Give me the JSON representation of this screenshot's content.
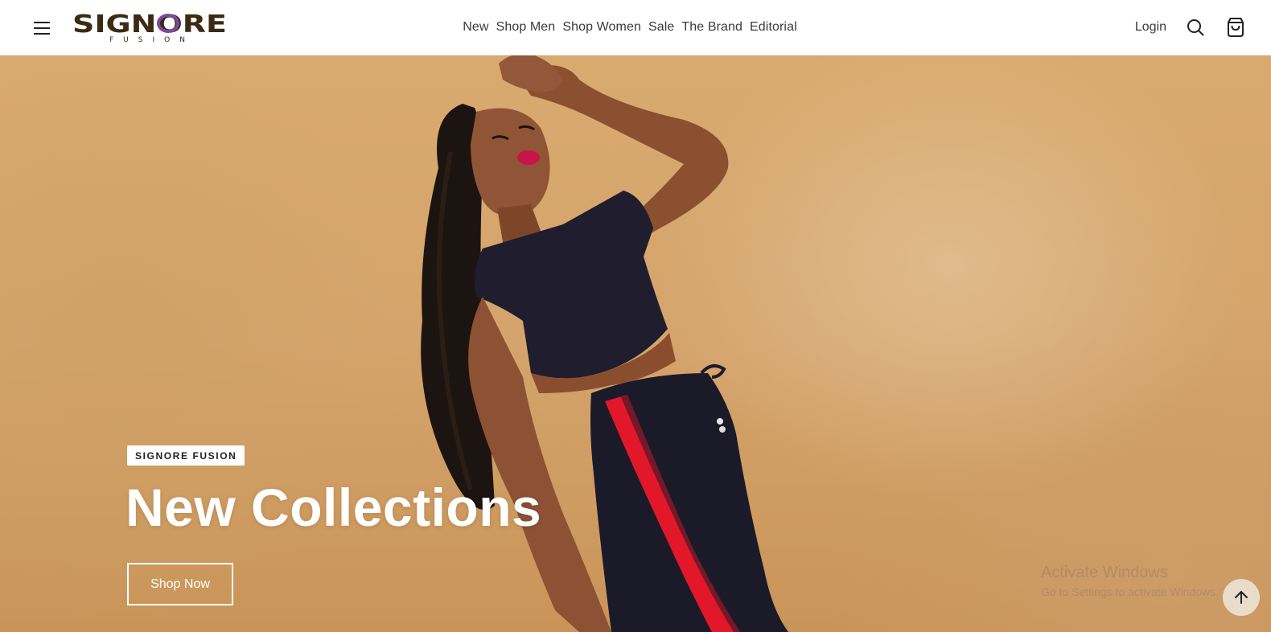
{
  "header": {
    "logo_text": "SIGNORE",
    "logo_subtext": "FUSION",
    "nav": [
      "New",
      "Shop Men",
      "Shop Women",
      "Sale",
      "The Brand",
      "Editorial"
    ],
    "login_label": "Login",
    "icons": {
      "menu": "hamburger-menu-icon",
      "search": "search-icon",
      "cart": "shopping-bag-icon"
    }
  },
  "hero": {
    "tag": "SIGNORE FUSION",
    "title": "New Collections",
    "cta": "Shop Now",
    "image_subject": "model in black crop top and black track pants with red side stripe against tan backdrop"
  },
  "overlay": {
    "watermark_title": "Activate Windows",
    "watermark_subtitle": "Go to Settings to activate Windows.",
    "back_to_top_icon": "arrow-up-icon"
  },
  "colors": {
    "background_tan": "#d4a46c",
    "text_dark": "#222222",
    "logo_purple": "#7a4a9a",
    "logo_brown": "#3b2a14",
    "stripe_red": "#e2182a"
  }
}
